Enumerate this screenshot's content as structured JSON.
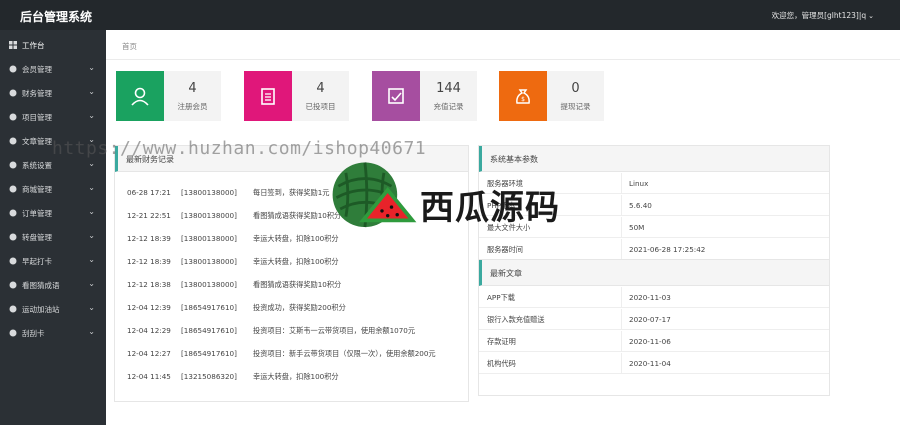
{
  "app": {
    "title": "后台管理系统"
  },
  "user": {
    "greeting": "欢迎您，管理员[glht123]|q",
    "caret": "⌄"
  },
  "sidebar": {
    "items": [
      {
        "label": "工作台",
        "icon": "dashboard-icon",
        "has_chevron": false
      },
      {
        "label": "会员管理",
        "icon": "user-gear-icon",
        "has_chevron": true
      },
      {
        "label": "财务管理",
        "icon": "finance-icon",
        "has_chevron": true
      },
      {
        "label": "项目管理",
        "icon": "project-icon",
        "has_chevron": true
      },
      {
        "label": "文章管理",
        "icon": "article-icon",
        "has_chevron": true
      },
      {
        "label": "系统设置",
        "icon": "gear-icon",
        "has_chevron": true
      },
      {
        "label": "商城管理",
        "icon": "shop-icon",
        "has_chevron": true
      },
      {
        "label": "订单管理",
        "icon": "order-icon",
        "has_chevron": true
      },
      {
        "label": "转盘管理",
        "icon": "wheel-icon",
        "has_chevron": true
      },
      {
        "label": "早起打卡",
        "icon": "checkin-icon",
        "has_chevron": true
      },
      {
        "label": "看图猜成语",
        "icon": "picture-icon",
        "has_chevron": true
      },
      {
        "label": "运动加油站",
        "icon": "sport-icon",
        "has_chevron": true
      },
      {
        "label": "刮刮卡",
        "icon": "card-icon",
        "has_chevron": true
      }
    ],
    "chevron": "⌄"
  },
  "breadcrumb": "首页",
  "stats": [
    {
      "value": "4",
      "label": "注册会员",
      "color": "#1aa260",
      "icon": "user-icon"
    },
    {
      "value": "4",
      "label": "已投项目",
      "color": "#e0177a",
      "icon": "clipboard-icon"
    },
    {
      "value": "144",
      "label": "充值记录",
      "color": "#a64ea0",
      "icon": "recharge-icon"
    },
    {
      "value": "0",
      "label": "提现记录",
      "color": "#ee6a10",
      "icon": "money-bag-icon"
    }
  ],
  "finance_log": {
    "title": "最新财务记录",
    "rows": [
      {
        "time": "06-28 17:21",
        "user": "[13800138000]",
        "text": "每日签到，获得奖励1元"
      },
      {
        "time": "12-21 22:51",
        "user": "[13800138000]",
        "text": "看图猜成语获得奖励10积分"
      },
      {
        "time": "12-12 18:39",
        "user": "[13800138000]",
        "text": "幸运大转盘，扣除100积分"
      },
      {
        "time": "12-12 18:39",
        "user": "[13800138000]",
        "text": "幸运大转盘，扣除100积分"
      },
      {
        "time": "12-12 18:38",
        "user": "[13800138000]",
        "text": "看图猜成语获得奖励10积分"
      },
      {
        "time": "12-04 12:39",
        "user": "[18654917610]",
        "text": "投资成功，获得奖励200积分"
      },
      {
        "time": "12-04 12:29",
        "user": "[18654917610]",
        "text": "投资项目：艾斯韦一云带货项目，使用余额1070元"
      },
      {
        "time": "12-04 12:27",
        "user": "[18654917610]",
        "text": "投资项目：新手云带货项目（仅限一次），使用余额200元"
      },
      {
        "time": "12-04 11:45",
        "user": "[13215086320]",
        "text": "幸运大转盘，扣除100积分"
      }
    ]
  },
  "system_params": {
    "title": "系统基本参数",
    "rows": [
      {
        "key": "服务器环境",
        "value": "Linux"
      },
      {
        "key": "PHP版本",
        "value": "5.6.40"
      },
      {
        "key": "最大文件大小",
        "value": "50M"
      },
      {
        "key": "服务器时间",
        "value": "2021-06-28 17:25:42"
      }
    ]
  },
  "latest_articles": {
    "title": "最新文章",
    "rows": [
      {
        "key": "APP下载",
        "value": "2020-11-03"
      },
      {
        "key": "银行入款充值赠送",
        "value": "2020-07-17"
      },
      {
        "key": "存款证明",
        "value": "2020-11-06"
      },
      {
        "key": "机构代码",
        "value": "2020-11-04"
      }
    ]
  },
  "watermark": {
    "url": "https://www.huzhan.com/ishop40671",
    "brand": "西瓜源码"
  }
}
